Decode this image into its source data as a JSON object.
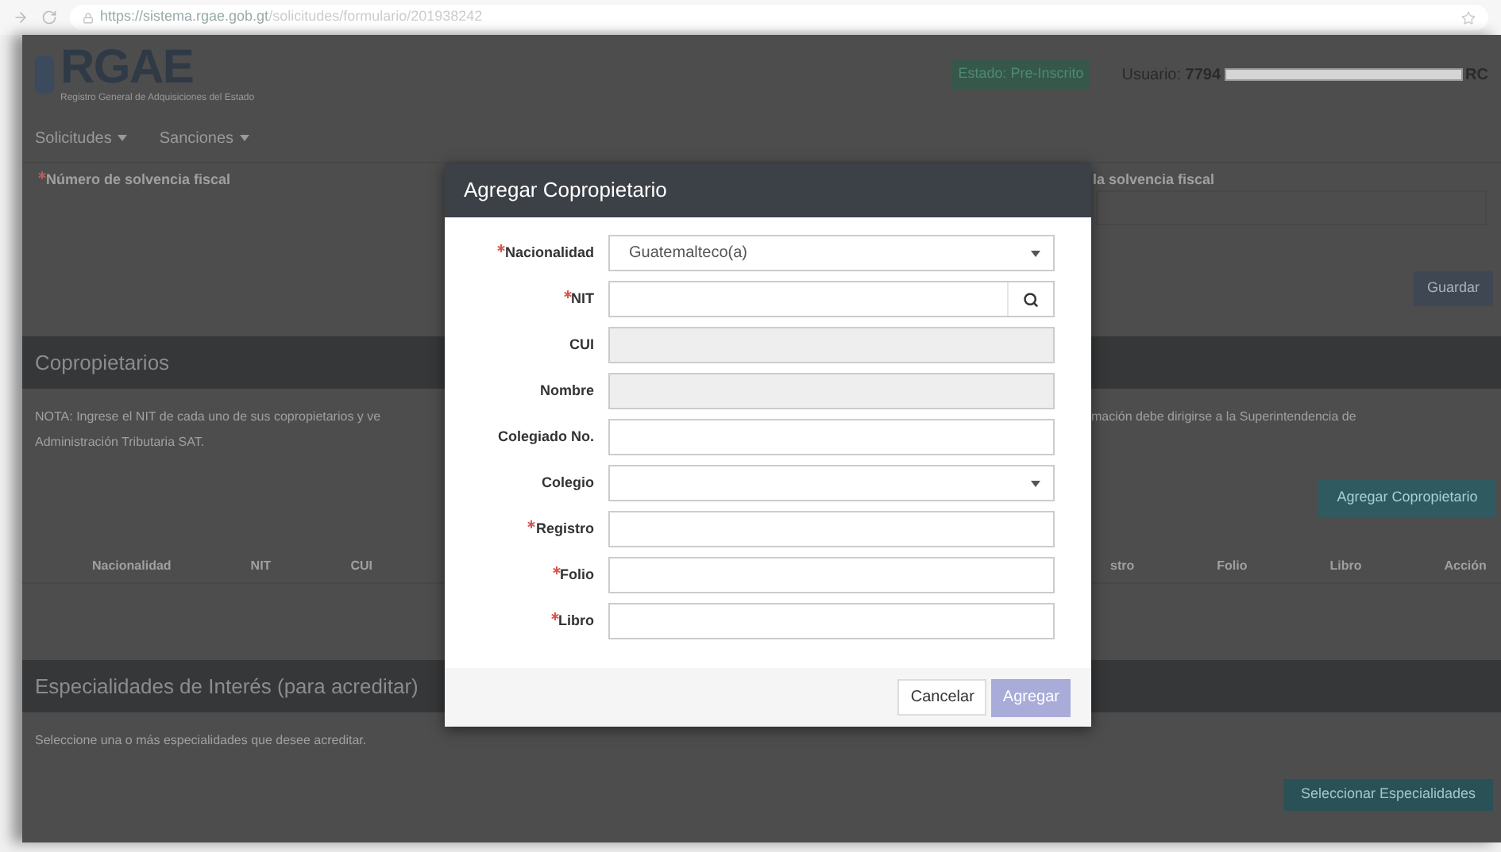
{
  "browser": {
    "url_host": "https://sistema.rgae.gob.gt",
    "url_path": "/solicitudes/formulario/201938242"
  },
  "header": {
    "logo": "RGAE",
    "logo_subtitle": "Registro General de Adquisiciones del Estado",
    "status_badge": "Estado: Pre-Inscrito",
    "user_label": "Usuario:",
    "user_value": "7794",
    "user_tail": "RC"
  },
  "nav": [
    {
      "label": "Solicitudes"
    },
    {
      "label": "Sanciones"
    }
  ],
  "solvency": {
    "left_label": "Número de solvencia fiscal",
    "left_required": true,
    "right_label": "la solvencia fiscal",
    "save_button": "Guardar"
  },
  "coowners": {
    "title": "Copropietarios",
    "note_left": "NOTA: Ingrese el NIT de cada uno de sus copropietarios y ve",
    "note_left_2": "Administración Tributaria SAT.",
    "note_right": "mación debe dirigirse a la Superintendencia de",
    "add_button": "Agregar Copropietario",
    "columns_left": [
      "Nacionalidad",
      "NIT",
      "CUI"
    ],
    "columns_right": [
      "stro",
      "Folio",
      "Libro",
      "Acción"
    ]
  },
  "specialties": {
    "title": "Especialidades de Interés (para acreditar)",
    "note": "Seleccione una o más especialidades que desee acreditar.",
    "button": "Seleccionar Especialidades"
  },
  "modal": {
    "title": "Agregar Copropietario",
    "fields": [
      {
        "label": "Nacionalidad",
        "required": true,
        "kind": "select",
        "value": "Guatemalteco(a)"
      },
      {
        "label": "NIT",
        "required": true,
        "kind": "search"
      },
      {
        "label": "CUI",
        "required": false,
        "kind": "disabled"
      },
      {
        "label": "Nombre",
        "required": false,
        "kind": "disabled"
      },
      {
        "label": "Colegiado No.",
        "required": false,
        "kind": "text"
      },
      {
        "label": "Colegio",
        "required": false,
        "kind": "select"
      },
      {
        "label": "Registro",
        "required": true,
        "kind": "text"
      },
      {
        "label": "Folio",
        "required": true,
        "kind": "text"
      },
      {
        "label": "Libro",
        "required": true,
        "kind": "text"
      }
    ],
    "cancel_button": "Cancelar",
    "submit_button": "Agregar",
    "submit_disabled": true
  }
}
